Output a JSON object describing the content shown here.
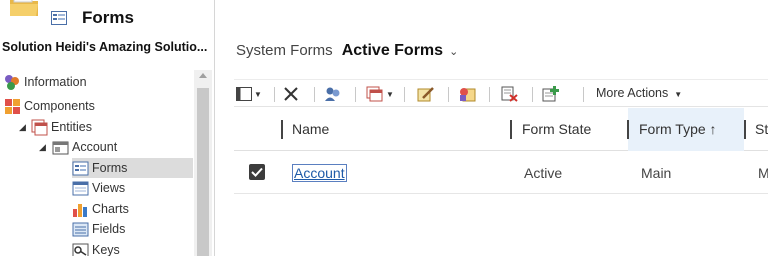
{
  "header": {
    "title": "Forms",
    "folder_icon": "folder-icon",
    "forms_icon": "forms-icon"
  },
  "solution": {
    "name": "Solution Heidi's Amazing Solutio..."
  },
  "tree": {
    "items": [
      {
        "label": "Information",
        "icon": "information-icon"
      },
      {
        "label": "Components",
        "icon": "components-icon"
      },
      {
        "label": "Entities",
        "icon": "entities-icon"
      },
      {
        "label": "Account",
        "icon": "account-entity-icon"
      },
      {
        "label": "Forms",
        "icon": "forms-icon",
        "selected": true
      },
      {
        "label": "Views",
        "icon": "views-icon"
      },
      {
        "label": "Charts",
        "icon": "charts-icon"
      },
      {
        "label": "Fields",
        "icon": "fields-icon"
      },
      {
        "label": "Keys",
        "icon": "keys-icon"
      }
    ]
  },
  "view": {
    "prefix": "System Forms",
    "name": "Active Forms"
  },
  "toolbar": {
    "buttons": [
      "view-selector-icon",
      "delete-icon",
      "assign-icon",
      "form-actions-icon",
      "edit-icon",
      "activate-icon",
      "deactivate-icon",
      "add-to-solution-icon"
    ],
    "more_actions": "More Actions"
  },
  "grid": {
    "columns": [
      "Name",
      "Form State",
      "Form Type ↑",
      "St"
    ],
    "sorted_column": "Form Type",
    "rows": [
      {
        "selected": true,
        "name": "Account",
        "form_state": "Active",
        "form_type": "Main",
        "status": "M"
      }
    ]
  },
  "colors": {
    "link": "#1e5aa8",
    "selected_tree_bg": "#dcdcdc",
    "sorted_header_bg": "#e8f1fa"
  }
}
